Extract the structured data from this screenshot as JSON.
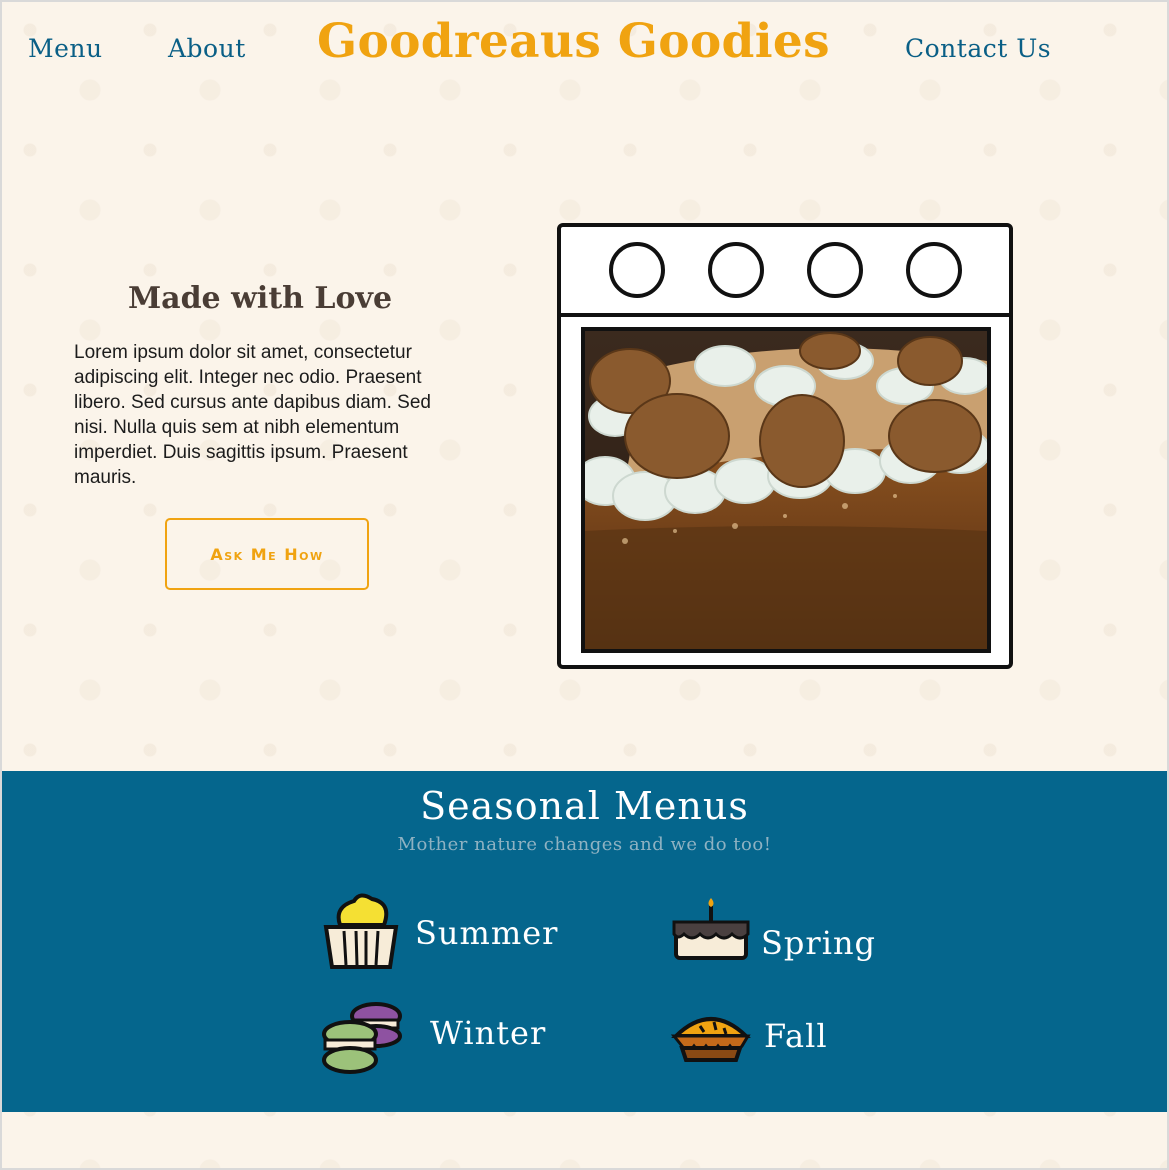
{
  "header": {
    "brand": "Goodreaus Goodies",
    "nav": {
      "menu": "Menu",
      "about": "About",
      "contact": "Contact Us"
    }
  },
  "hero": {
    "title": "Made with Love",
    "body": "Lorem ipsum dolor sit amet, consectetur adipiscing elit. Integer nec odio. Praesent libero. Sed cursus ante dapibus diam. Sed nisi. Nulla quis sem at nibh elementum imperdiet. Duis sagittis ipsum. Praesent mauris.",
    "button": "Ask Me How"
  },
  "seasonal": {
    "title": "Seasonal Menus",
    "subtitle": "Mother nature changes and we do too!",
    "items": {
      "summer": {
        "label": "Summer",
        "icon": "cupcake-icon"
      },
      "spring": {
        "label": "Spring",
        "icon": "birthday-cake-icon"
      },
      "winter": {
        "label": "Winter",
        "icon": "macarons-icon"
      },
      "fall": {
        "label": "Fall",
        "icon": "pie-icon"
      }
    }
  },
  "colors": {
    "brand": "#f0a311",
    "nav": "#0a5f86",
    "band": "#05668d",
    "background": "#fbf4ea"
  }
}
